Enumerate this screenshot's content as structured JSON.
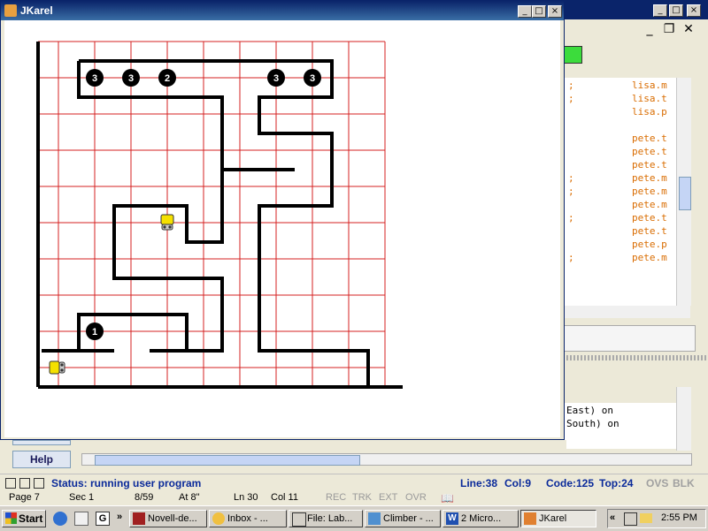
{
  "ide": {
    "code_lines": [
      {
        "semi": ";",
        "text": "lisa.m"
      },
      {
        "semi": ";",
        "text": "lisa.t"
      },
      {
        "semi": "",
        "text": "lisa.p"
      },
      {
        "semi": "",
        "text": ""
      },
      {
        "semi": "",
        "text": "pete.t"
      },
      {
        "semi": "",
        "text": "pete.t"
      },
      {
        "semi": "",
        "text": "pete.t"
      },
      {
        "semi": ";",
        "text": "pete.m"
      },
      {
        "semi": ";",
        "text": "pete.m"
      },
      {
        "semi": "",
        "text": "pete.m"
      },
      {
        "semi": ";",
        "text": "pete.t"
      },
      {
        "semi": "",
        "text": "pete.t"
      },
      {
        "semi": "",
        "text": "pete.p"
      },
      {
        "semi": ";",
        "text": "pete.m"
      }
    ],
    "output_lines": [
      "East) on",
      "South) on"
    ]
  },
  "jkarel": {
    "title": "JKarel",
    "beepers": [
      {
        "label": "3"
      },
      {
        "label": "3"
      },
      {
        "label": "2"
      },
      {
        "label": "3"
      },
      {
        "label": "3"
      },
      {
        "label": "1"
      }
    ]
  },
  "help_label": "Help",
  "status": {
    "text": "Status: running user program",
    "line": "Line:38",
    "col": "Col:9",
    "code": "Code:125",
    "top": "Top:24",
    "ovs": "OVS",
    "blk": "BLK"
  },
  "word_bar": {
    "page": "Page 7",
    "sec": "Sec 1",
    "pages": "8/59",
    "at": "At 8\"",
    "ln": "Ln 30",
    "col": "Col 11",
    "rec": "REC",
    "trk": "TRK",
    "ext": "EXT",
    "ovr": "OVR"
  },
  "taskbar": {
    "start": "Start",
    "tasks": [
      "Novell-de...",
      "Inbox - ...",
      "File: Lab...",
      "Climber - ...",
      "2 Micro...",
      "JKarel"
    ],
    "clock": "2:55 PM"
  },
  "colors": {
    "grid": "#d42020",
    "wall": "#000000",
    "code_text": "#d96c00",
    "status_text": "#0a2a9a",
    "robot": "#f5e000"
  }
}
